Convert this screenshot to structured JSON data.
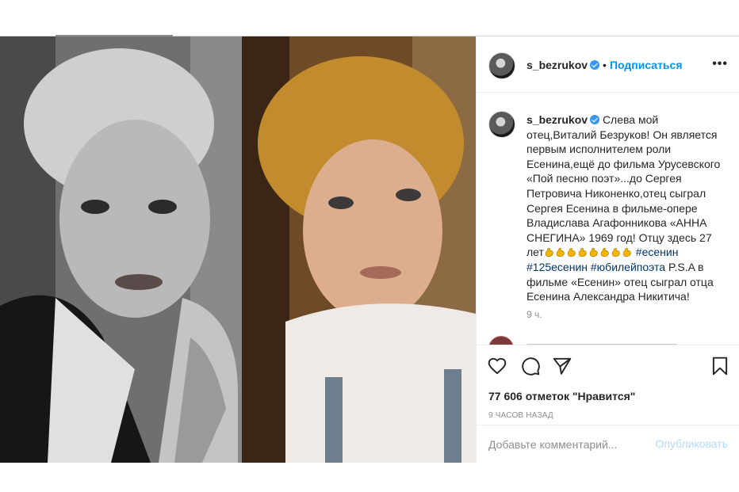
{
  "post": {
    "username": "s_bezrukov",
    "follow_label": "Подписаться",
    "separator": "•",
    "more_label": "•••"
  },
  "caption": {
    "username": "s_bezrukov",
    "text_before_emoji": "Слева мой отец,Виталий Безруков! Он является первым исполнителем роли Есенина,ещё до фильма Урусевского «Пой песню поэт»...до Сергея Петровича Никоненко,отец сыграл Сергея Есенина в фильме-опере Владислава Агафонникова «АННА СНЕГИНА» 1969 год! Отцу здесь 27 лет",
    "emoji_icon": "flexed-biceps-icon",
    "emoji_count": 8,
    "hashtag_1": "#есенин",
    "hashtag_2": "#125есенин",
    "hashtag_3": "#юбилейпоэта",
    "text_after": "P.S.A в фильме «Есенин» отец сыграл отца Есенина Александра Никитича!",
    "time_ago": "9 ч."
  },
  "actions": {
    "like_icon": "heart-icon",
    "comment_icon": "comment-icon",
    "share_icon": "paper-plane-icon",
    "save_icon": "bookmark-icon"
  },
  "likes_text": "77 606 отметок \"Нравится\"",
  "timestamp_text": "9 ЧАСОВ НАЗАД",
  "comment_box": {
    "placeholder": "Добавьте комментарий...",
    "publish_label": "Опубликовать"
  },
  "colors": {
    "accent": "#0095f6",
    "verified": "#3897f0",
    "hashtag": "#00376b",
    "publish_disabled": "#b3dbff",
    "muted": "#8e8e8e"
  }
}
